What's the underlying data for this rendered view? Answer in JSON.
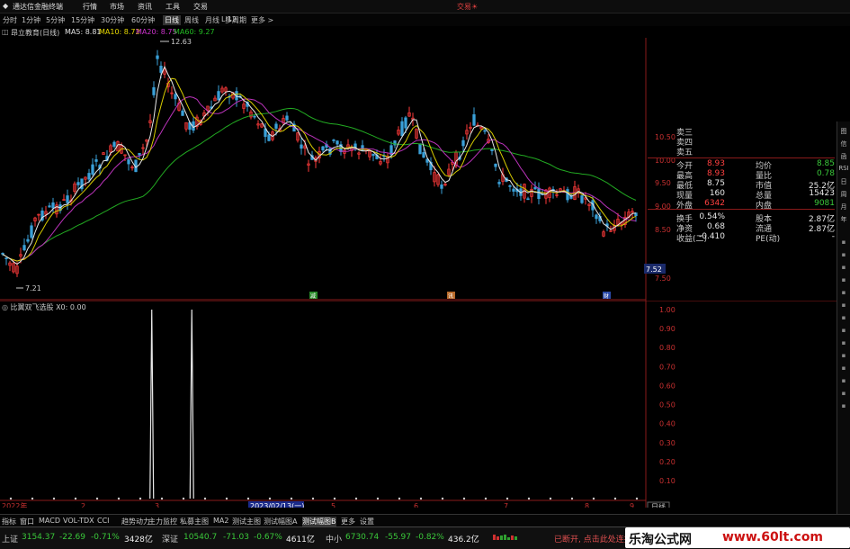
{
  "titlebar": {
    "app_name": "通达信金融终端",
    "menu": [
      "行情",
      "市场",
      "资讯",
      "工具",
      "交易"
    ],
    "right_label": "交易☀"
  },
  "periods": {
    "items": [
      "分时",
      "1分钟",
      "5分钟",
      "15分钟",
      "30分钟",
      "60分钟",
      "日线",
      "周线",
      "月线",
      "多周期",
      "更多 >"
    ],
    "active_index": 6,
    "chart_tag": "LI12"
  },
  "main_chart": {
    "stock_label": "昂立教育(日线)",
    "ma": [
      {
        "label": "MA5: 8.81",
        "color": "#e0e0e0"
      },
      {
        "label": "MA10: 8.72",
        "color": "#e6d800"
      },
      {
        "label": "MA20: 8.75",
        "color": "#cc33cc"
      },
      {
        "label": "MA60: 9.27",
        "color": "#22bb22"
      }
    ],
    "high_label": "12.63",
    "low_label": "7.21",
    "price_axis": [
      "10.50",
      "10.00",
      "9.50",
      "9.00",
      "8.50"
    ],
    "current_price_tag": "7.52",
    "axis_min_label": "7.50",
    "event_markers": [
      "减",
      "讯",
      "财"
    ]
  },
  "quote": {
    "ask_rows": [
      "卖三",
      "卖四",
      "卖五"
    ],
    "rows": [
      {
        "k1": "今开",
        "v1": "8.93",
        "k2": "均价",
        "v2": "8.85"
      },
      {
        "k1": "最高",
        "v1": "8.93",
        "k2": "量比",
        "v2": "0.78"
      },
      {
        "k1": "最低",
        "v1": "8.75",
        "k2": "市值",
        "v2": "25.2亿"
      },
      {
        "k1": "现量",
        "v1": "160",
        "k2": "总量",
        "v2": "15423"
      },
      {
        "k1": "外盘",
        "v1": "6342",
        "k2": "内盘",
        "v2": "9081"
      },
      {
        "k1": "换手",
        "v1": "0.54%",
        "k2": "股本",
        "v2": "2.87亿"
      },
      {
        "k1": "净资",
        "v1": "0.68",
        "k2": "流通",
        "v2": "2.87亿"
      },
      {
        "k1": "收益(二)",
        "v1": "-0.410",
        "k2": "PE(动)",
        "v2": "-"
      }
    ]
  },
  "sub_chart": {
    "title": "比翼双飞选股 X0: 0.00",
    "y_axis": [
      "1.00",
      "0.90",
      "0.80",
      "0.70",
      "0.60",
      "0.50",
      "0.40",
      "0.30",
      "0.20",
      "0.10"
    ],
    "x_labels": [
      "2022年",
      "2",
      "3",
      "2023/02/13(一)",
      "5",
      "6",
      "7",
      "8",
      "9"
    ],
    "period_tag": "日线"
  },
  "chart_data": {
    "type": "bar",
    "title": "比翼双飞选股",
    "series": [
      {
        "name": "X0",
        "signal_positions": [
          0.235,
          0.297
        ],
        "values": [
          1,
          1
        ]
      }
    ],
    "ylim": [
      0,
      1
    ]
  },
  "tabs": [
    "指标",
    "窗口",
    "MACD",
    "VOL-TDX",
    "CCI",
    "趋势动力",
    "主力监控",
    "私募主图",
    "MA2",
    "测试主图",
    "测试幅图A",
    "测试幅图B",
    "更多",
    "设置"
  ],
  "status": {
    "index1": {
      "name": "上证",
      "value": "3154.37",
      "change": "-22.69",
      "pct": "-0.71%",
      "amount": "3428亿"
    },
    "index2": {
      "name": "深证",
      "value": "10540.7",
      "change": "-71.03",
      "pct": "-0.67%",
      "amount": "4611亿"
    },
    "index3": {
      "name": "中小",
      "value": "6730.74",
      "change": "-55.97",
      "pct": "-0.82%",
      "amount": "436.2亿"
    },
    "connection": "已断开, 点击此处连接"
  },
  "watermark": {
    "brand": "乐淘公式网",
    "url": "www.60lt.com"
  },
  "right_toolbar": [
    "图",
    "信",
    "函",
    "RSI",
    "日",
    "周",
    "月",
    "年"
  ]
}
